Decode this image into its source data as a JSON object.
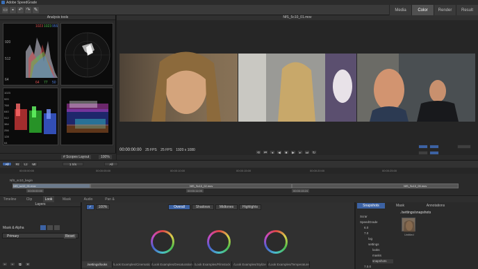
{
  "app": {
    "title": "Adobe SpeedGrade"
  },
  "main_tabs": [
    "Media",
    "Color",
    "Render",
    "Result"
  ],
  "active_main_tab": "Color",
  "analysis": {
    "title": "Analysis tools",
    "scope_values_top": [
      "1023",
      "1023",
      "955"
    ],
    "scope_labels_left": [
      "920",
      "512",
      "64"
    ],
    "scope_labels_bottom": [
      "64",
      "77",
      "50"
    ],
    "parade_labels": [
      "1023",
      "920",
      "768",
      "640",
      "512",
      "384",
      "256",
      "128",
      "64"
    ],
    "layout_select": "# Scopes Layout",
    "zoom": "100%"
  },
  "viewer": {
    "file_title": "NfS_5c10_01.mov",
    "timecode": "00:00:00:00",
    "fps1": "25 FPS",
    "fps2": "25 FPS",
    "resolution": "1920 x 1080"
  },
  "timeline": {
    "toolbar": {
      "all": "All",
      "tab2": "Rt",
      "tab3": "Lt",
      "tab4": "Mt",
      "playback": "1 X/s",
      "all2": "All"
    },
    "ruler_labels": [
      "00:00:00:00",
      "00:00:05:00",
      "00:00:10:00",
      "00:00:15:00",
      "00:00:20:00",
      "00:00:25:00"
    ],
    "track_name": "NfS_sc10_begin",
    "clips": [
      "NfS_sc10_01.mov",
      "NfS_Sc10_02.mov",
      "NfS_Sc10_05.mov"
    ],
    "clip_times": [
      "00:00:00:00",
      "00:00:11:09",
      "00:00:15:24"
    ]
  },
  "bottom_tabs": [
    "Timeline",
    "Clip",
    "Look",
    "Mask",
    "Audio",
    "Pan & Scan"
  ],
  "active_bottom_tab": "Look",
  "layers": {
    "title": "Layers",
    "row_label": "Mask & Alpha",
    "primary": "Primary",
    "reset": "Reset"
  },
  "color": {
    "zoom": "100%",
    "tabs": [
      "Overall",
      "Shadows",
      "Midtones",
      "Highlights"
    ],
    "active_tab": "Overall"
  },
  "right_panel": {
    "tabs": [
      "Snapshots",
      "Mask",
      "Annotations"
    ],
    "path": "./settings/snapshots",
    "folders": [
      "Scrar",
      "SpeedGrade",
      "6.0",
      "7.0",
      "log",
      "settings",
      "looks",
      "masks",
      "snapshots",
      "7.0.0"
    ],
    "snapshot_label": "Untitled"
  },
  "look_tabs": [
    "./settings/looks",
    "/Look Examples/Cinematic",
    "/Look Examples/Desaturation",
    "/Look Examples/Filmstock",
    "/Look Examples/Stylize",
    "/Look Examples/Temperature"
  ]
}
